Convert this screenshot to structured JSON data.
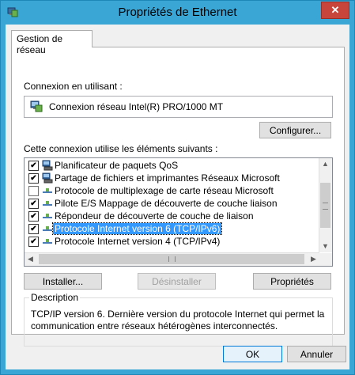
{
  "window": {
    "title": "Propriétés de Ethernet",
    "close_glyph": "✕"
  },
  "tabs": [
    {
      "label": "Gestion de réseau",
      "selected": true
    }
  ],
  "connection": {
    "label": "Connexion en utilisant :",
    "adapter": "Connexion réseau Intel(R) PRO/1000 MT",
    "adapter_icon": "network-adapter-icon",
    "configure_label": "Configurer..."
  },
  "components": {
    "label": "Cette connexion utilise les éléments suivants :",
    "items": [
      {
        "label": "Planificateur de paquets QoS",
        "checked": true,
        "icon": "network-service-icon"
      },
      {
        "label": "Partage de fichiers et imprimantes Réseaux Microsoft",
        "checked": true,
        "icon": "network-service-icon"
      },
      {
        "label": "Protocole de multiplexage de carte réseau Microsoft",
        "checked": false,
        "icon": "protocol-icon"
      },
      {
        "label": "Pilote E/S Mappage de découverte de couche liaison",
        "checked": true,
        "icon": "protocol-icon"
      },
      {
        "label": "Répondeur de découverte de couche de liaison",
        "checked": true,
        "icon": "protocol-icon"
      },
      {
        "label": "Protocole Internet version 6 (TCP/IPv6)",
        "checked": true,
        "icon": "protocol-icon",
        "selected": true
      },
      {
        "label": "Protocole Internet version 4 (TCP/IPv4)",
        "checked": true,
        "icon": "protocol-icon"
      }
    ],
    "check_glyph": "✔"
  },
  "actions": {
    "install_label": "Installer...",
    "uninstall_label": "Désinstaller",
    "properties_label": "Propriétés"
  },
  "description": {
    "title": "Description",
    "text": "TCP/IP version 6. Dernière version du protocole Internet qui permet la communication entre réseaux hétérogènes interconnectés."
  },
  "footer": {
    "ok_label": "OK",
    "cancel_label": "Annuler"
  },
  "colors": {
    "title_bar": "#39a6d6",
    "close_button": "#c7453a",
    "selection": "#3399ff",
    "default_button_border": "#0078d7"
  }
}
